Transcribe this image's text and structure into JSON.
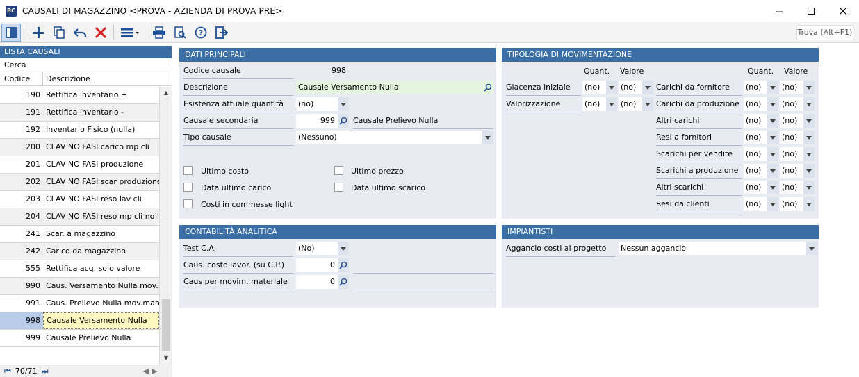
{
  "window": {
    "title": "CAUSALI DI MAGAZZINO <PROVA - AZIENDA DI PROVA PRE>",
    "app_icon_text": "BC"
  },
  "toolbar": {
    "search_label": "Trova (Alt+F1)"
  },
  "list": {
    "header": "LISTA CAUSALI",
    "search_label": "Cerca",
    "col_code": "Codice",
    "col_desc": "Descrizione",
    "rows": [
      {
        "code": "190",
        "desc": "Rettifica inventario +"
      },
      {
        "code": "191",
        "desc": "Rettifica Inventario -"
      },
      {
        "code": "192",
        "desc": "Inventario Fisico (nulla)"
      },
      {
        "code": "200",
        "desc": "CLAV NO FASI carico mp cli"
      },
      {
        "code": "201",
        "desc": "CLAV NO FASI produzione"
      },
      {
        "code": "202",
        "desc": "CLAV NO FASI scar produzione"
      },
      {
        "code": "203",
        "desc": "CLAV NO FASI reso lav cli"
      },
      {
        "code": "204",
        "desc": "CLAV NO FASI reso mp cli no la"
      },
      {
        "code": "241",
        "desc": "Scar. a magazzino"
      },
      {
        "code": "242",
        "desc": "Carico da magazzino"
      },
      {
        "code": "555",
        "desc": "Rettifica acq. solo valore"
      },
      {
        "code": "990",
        "desc": "Caus. Versamento Nulla mov...."
      },
      {
        "code": "991",
        "desc": "Caus. Prelievo Nulla mov.man"
      },
      {
        "code": "998",
        "desc": "Causale Versamento Nulla"
      },
      {
        "code": "999",
        "desc": "Causale Prelievo Nulla"
      }
    ],
    "selected_code": "998",
    "record_position": "70/71"
  },
  "dati_principali": {
    "title": "DATI PRINCIPALI",
    "codice_label": "Codice causale",
    "codice_value": "998",
    "descrizione_label": "Descrizione",
    "descrizione_value": "Causale Versamento Nulla",
    "esistenza_label": "Esistenza attuale quantità",
    "esistenza_value": "(no)",
    "secondaria_label": "Causale secondaria",
    "secondaria_code": "999",
    "secondaria_desc": "Causale Prelievo Nulla",
    "tipo_label": "Tipo causale",
    "tipo_value": "(Nessuno)",
    "chk_ultimo_costo": "Ultimo costo",
    "chk_ultimo_prezzo": "Ultimo prezzo",
    "chk_data_ultimo_carico": "Data ultimo carico",
    "chk_data_ultimo_scarico": "Data ultimo scarico",
    "chk_costi_commesse": "Costi in commesse light"
  },
  "tipologia": {
    "title": "TIPOLOGIA DI MOVIMENTAZIONE",
    "quant_header": "Quant.",
    "valore_header": "Valore",
    "left_rows": [
      {
        "label": "Giacenza iniziale",
        "quant": "(no)",
        "valore": "(no)"
      },
      {
        "label": "Valorizzazione",
        "quant": "(no)",
        "valore": "(no)"
      }
    ],
    "right_rows": [
      {
        "label": "Carichi da fornitore",
        "quant": "(no)",
        "valore": "(no)"
      },
      {
        "label": "Carichi da produzione",
        "quant": "(no)",
        "valore": "(no)"
      },
      {
        "label": "Altri carichi",
        "quant": "(no)",
        "valore": "(no)"
      },
      {
        "label": "Resi a fornitori",
        "quant": "(no)",
        "valore": "(no)"
      },
      {
        "label": "Scarichi per vendite",
        "quant": "(no)",
        "valore": "(no)"
      },
      {
        "label": "Scarichi a produzione",
        "quant": "(no)",
        "valore": "(no)"
      },
      {
        "label": "Altri scarichi",
        "quant": "(no)",
        "valore": "(no)"
      },
      {
        "label": "Resi da clienti",
        "quant": "(no)",
        "valore": "(no)"
      }
    ]
  },
  "contabilita": {
    "title": "CONTABILITÀ ANALITICA",
    "test_label": "Test C.A.",
    "test_value": "(No)",
    "caus_costo_label": "Caus. costo lavor. (su C.P.)",
    "caus_costo_value": "0",
    "caus_movim_label": "Caus per movim. materiale",
    "caus_movim_value": "0"
  },
  "impiantisti": {
    "title": "IMPIANTISTI",
    "aggancio_label": "Aggancio costi al progetto",
    "aggancio_value": "Nessun aggancio"
  },
  "colors": {
    "panel_header": "#3a6ea5",
    "panel_bg": "#e8ecf2",
    "selected_row": "#fff8c0",
    "description_field": "#e4f4de"
  }
}
